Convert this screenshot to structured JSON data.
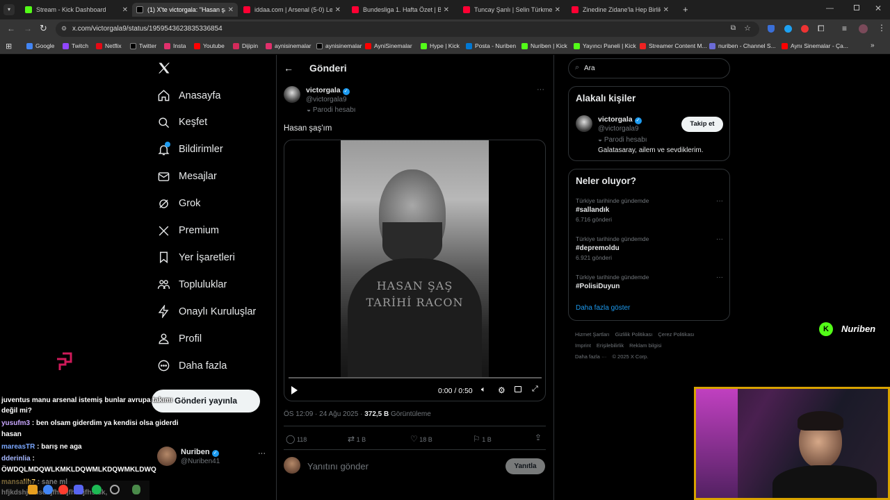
{
  "browser": {
    "tabs": [
      {
        "label": "Stream - Kick Dashboard",
        "color": "#53fc18"
      },
      {
        "label": "(1) X'te victorgala: \"Hasan şaş'ım\"",
        "color": "#000000"
      },
      {
        "label": "iddaa.com | Arsenal (5-0) Leeds",
        "color": "#ff0033"
      },
      {
        "label": "Bundesliga 1. Hafta Özet | Bayer",
        "color": "#ff0033"
      },
      {
        "label": "Tuncay Şanlı | Selin Türkmen | K",
        "color": "#ff0033"
      },
      {
        "label": "Zinedine Zidane'la Hep Birlikte",
        "color": "#ff0033"
      }
    ],
    "url": "x.com/victorgala9/status/1959543623835336854",
    "bookmarks": [
      {
        "label": "Google",
        "color": "#4285f4"
      },
      {
        "label": "Twitch",
        "color": "#9146ff"
      },
      {
        "label": "Netflix",
        "color": "#e50914"
      },
      {
        "label": "Twitter",
        "color": "#000000"
      },
      {
        "label": "Insta",
        "color": "#e1306c"
      },
      {
        "label": "Youtube",
        "color": "#ff0000"
      },
      {
        "label": "Dijipin",
        "color": "#d42a5b"
      },
      {
        "label": "aynisinemalar",
        "color": "#e1306c"
      },
      {
        "label": "aynisinemalar",
        "color": "#000000"
      },
      {
        "label": "AyniSinemalar",
        "color": "#ff0000"
      },
      {
        "label": "Hype | Kick",
        "color": "#53fc18"
      },
      {
        "label": "Posta - Nuriben",
        "color": "#0078d4"
      },
      {
        "label": "Nuriben | Kick",
        "color": "#53fc18"
      },
      {
        "label": "Yayıncı Paneli | Kick",
        "color": "#53fc18"
      },
      {
        "label": "Streamer Content M...",
        "color": "#e22"
      },
      {
        "label": "nuriben - Channel S...",
        "color": "#6b6bd6"
      },
      {
        "label": "Aynı Sinemalar - Ça...",
        "color": "#ff0000"
      }
    ]
  },
  "sidebar": {
    "nav": [
      {
        "label": "Anasayfa",
        "icon": "home-icon"
      },
      {
        "label": "Keşfet",
        "icon": "search-icon"
      },
      {
        "label": "Bildirimler",
        "icon": "bell-icon"
      },
      {
        "label": "Mesajlar",
        "icon": "mail-icon"
      },
      {
        "label": "Grok",
        "icon": "grok-icon"
      },
      {
        "label": "Premium",
        "icon": "x-icon"
      },
      {
        "label": "Yer İşaretleri",
        "icon": "bookmark-icon"
      },
      {
        "label": "Topluluklar",
        "icon": "people-icon"
      },
      {
        "label": "Onaylı Kuruluşlar",
        "icon": "bolt-icon"
      },
      {
        "label": "Profil",
        "icon": "person-icon"
      },
      {
        "label": "Daha fazla",
        "icon": "more-circle-icon"
      }
    ],
    "post_button": "Gönderi yayınla",
    "account": {
      "name": "Nuriben",
      "handle": "@Nuriben41"
    }
  },
  "post": {
    "header": "Gönderi",
    "author": {
      "name": "victorgala",
      "handle": "@victorgala9",
      "label": "Parodi hesabı"
    },
    "text": "Hasan şaş'ım",
    "video": {
      "caption_line1": "HASAN ŞAŞ",
      "caption_line2": "TARİHİ RACON",
      "time": "0:00 / 0:50"
    },
    "timestamp": "ÖS 12:09 · 24 Ağu 2025 · ",
    "views": "372,5 B",
    "views_label": "Görüntüleme",
    "stats": {
      "replies": "118",
      "reposts": "1 B",
      "likes": "18 B",
      "bookmarks": "1 B"
    },
    "reply_placeholder": "Yanıtını gönder",
    "reply_button": "Yanıtla"
  },
  "right": {
    "search_placeholder": "Ara",
    "relevant_title": "Alakalı kişiler",
    "person": {
      "name": "victorgala",
      "handle": "@victorgala9",
      "label": "Parodi hesabı",
      "bio": "Galatasaray, ailem ve sevdiklerim.",
      "follow": "Takip et"
    },
    "trends_title": "Neler oluyor?",
    "trends": [
      {
        "context": "Türkiye tarihinde gündemde",
        "tag": "#sallandık",
        "count": "6.716 gönderi"
      },
      {
        "context": "Türkiye tarihinde gündemde",
        "tag": "#depremoldu",
        "count": "6.921 gönderi"
      },
      {
        "context": "Türkiye tarihinde gündemde",
        "tag": "#PolisiDuyun",
        "count": ""
      }
    ],
    "show_more": "Daha fazla göster",
    "footer": [
      "Hizmet Şartları",
      "Gizlilik Politikası",
      "Çerez Politikası",
      "Imprint",
      "Erişilebilirlik",
      "Reklam bilgisi",
      "Daha fazla ···",
      "© 2025 X Corp."
    ]
  },
  "overlay": {
    "brand": "Nuriben",
    "chat": [
      {
        "user": "",
        "msg": "juventus manu arsenal istemiş bunlar avrupa takımı",
        "color": "#ffffff"
      },
      {
        "user": "",
        "msg": "değil mi?",
        "color": "#ffffff"
      },
      {
        "user": "yusufm3",
        "msg": ": ben olsam giderdim ya kendisi olsa giderdi",
        "color": "#c9a7ff"
      },
      {
        "user": "",
        "msg": "hasan",
        "color": "#ffffff"
      },
      {
        "user": "mareasTR",
        "msg": ": barış ne aga",
        "color": "#7aa7ff"
      },
      {
        "user": "dderinlia",
        "msg": ":",
        "color": "#a7b8ff"
      },
      {
        "user": "",
        "msg": "ÖWDQLMDQWLKMKLDQWMLKDQWMKLDWQ",
        "color": "#ffffff"
      },
      {
        "user": "mansalih7",
        "msg": ": sane mi",
        "color": "#ffd36b"
      },
      {
        "user": "",
        "msg": "hfjkdshjkfhsdkjfhskjfhskjfhsfsk,",
        "color": "#ffffff"
      }
    ]
  }
}
